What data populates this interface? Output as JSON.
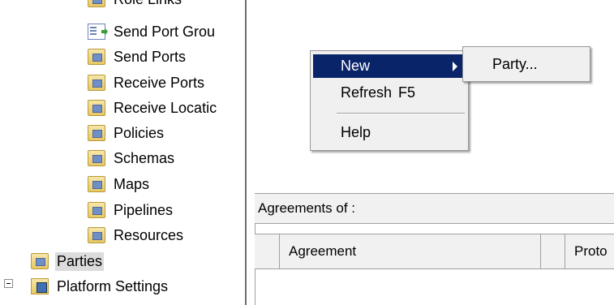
{
  "tree": {
    "items": [
      {
        "label": "Role Links",
        "icon": "role-links-icon"
      },
      {
        "label": "Send Port Grou",
        "icon": "send-port-group-icon"
      },
      {
        "label": "Send Ports",
        "icon": "send-ports-icon"
      },
      {
        "label": "Receive Ports",
        "icon": "receive-ports-icon"
      },
      {
        "label": "Receive Locatic",
        "icon": "receive-locations-icon"
      },
      {
        "label": "Policies",
        "icon": "policies-icon"
      },
      {
        "label": "Schemas",
        "icon": "schemas-icon"
      },
      {
        "label": "Maps",
        "icon": "maps-icon"
      },
      {
        "label": "Pipelines",
        "icon": "pipelines-icon"
      },
      {
        "label": "Resources",
        "icon": "resources-icon"
      }
    ],
    "parties": {
      "label": "Parties",
      "icon": "parties-icon"
    },
    "platform": {
      "label": "Platform Settings",
      "icon": "platform-settings-icon"
    }
  },
  "context_menu": {
    "new_label": "New",
    "refresh_label": "Refresh",
    "refresh_shortcut": "F5",
    "help_label": "Help"
  },
  "submenu": {
    "party_label": "Party..."
  },
  "agreements": {
    "header": "Agreements of :",
    "columns": [
      "Agreement",
      "Proto"
    ]
  },
  "colors": {
    "menu_highlight": "#0a246a",
    "menu_bg": "#f0f0f0"
  }
}
